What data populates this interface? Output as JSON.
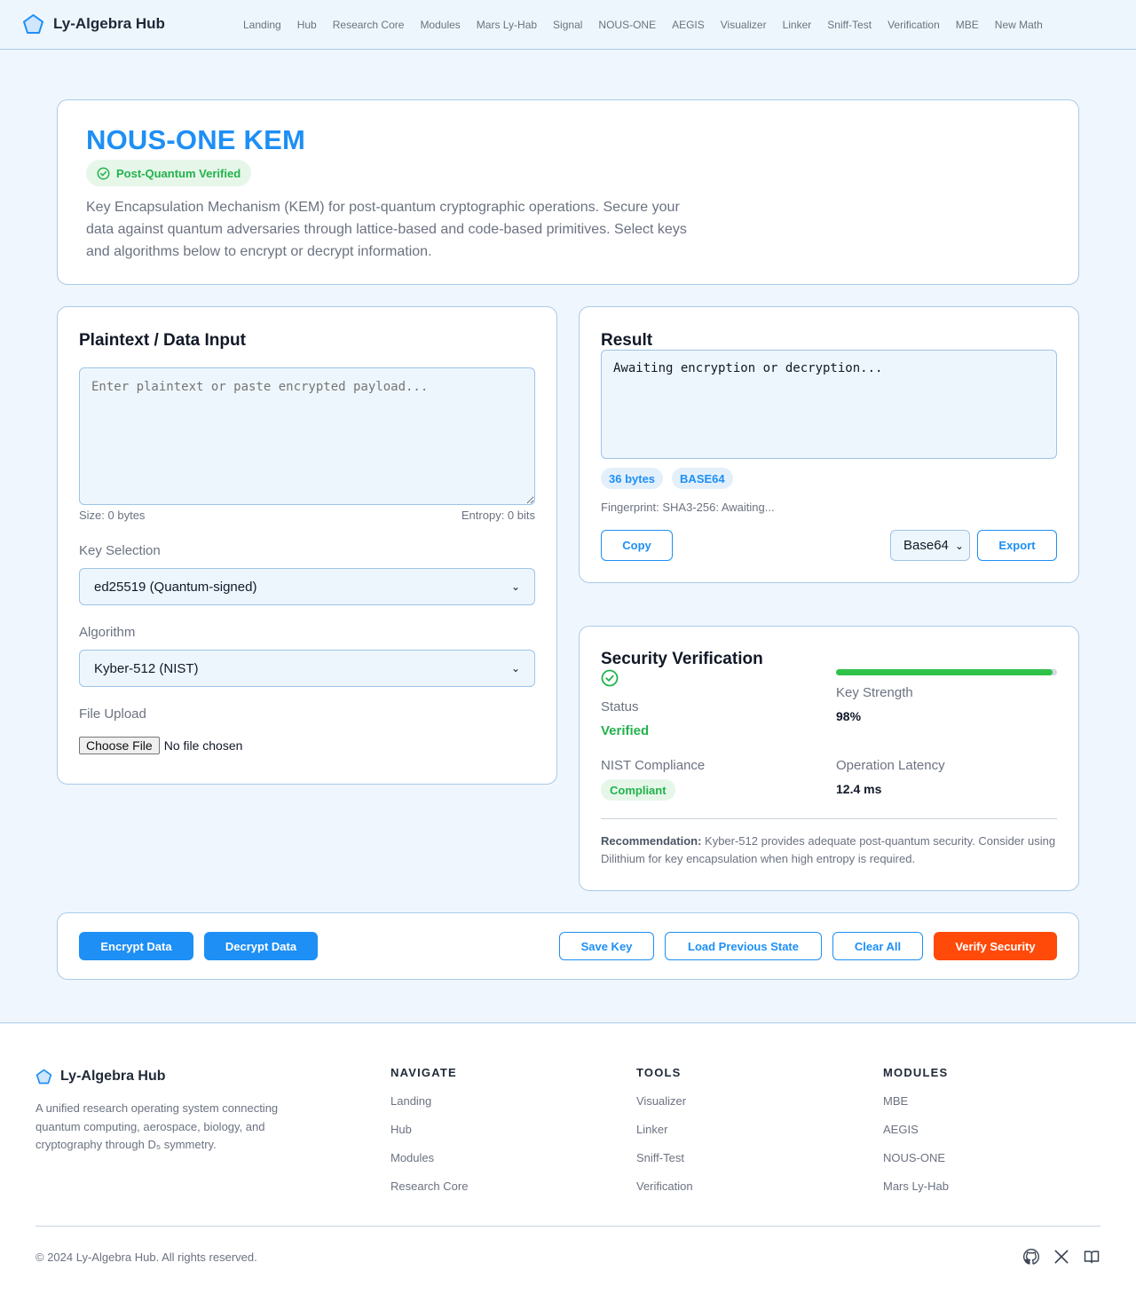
{
  "brand": {
    "name": "Ly-Algebra Hub",
    "logo_icon": "pentagon-icon"
  },
  "nav": [
    "Landing",
    "Hub",
    "Research Core",
    "Modules",
    "Mars Ly-Hab",
    "Signal",
    "NOUS-ONE",
    "AEGIS",
    "Visualizer",
    "Linker",
    "Sniff-Test",
    "Verification",
    "MBE",
    "New Math"
  ],
  "hero": {
    "title": "NOUS-ONE KEM",
    "badge": "Post-Quantum Verified",
    "description": "Key Encapsulation Mechanism (KEM) for post-quantum cryptographic operations. Secure your data against quantum adversaries through lattice-based and code-based primitives. Select keys and algorithms below to encrypt or decrypt information."
  },
  "input": {
    "title": "Plaintext / Data Input",
    "placeholder": "Enter plaintext or paste encrypted payload...",
    "size": "Size: 0 bytes",
    "entropy": "Entropy: 0 bits",
    "key_label": "Key Selection",
    "key_value": "ed25519 (Quantum-signed)",
    "algo_label": "Algorithm",
    "algo_value": "Kyber-512 (NIST)",
    "file_label": "File Upload",
    "file_button": "Choose File",
    "file_status": "No file chosen"
  },
  "result": {
    "title": "Result",
    "output": "Awaiting encryption or decryption...",
    "bytes_pill": "36 bytes",
    "format_pill": "BASE64",
    "fingerprint": "Fingerprint: SHA3-256: Awaiting...",
    "copy_label": "Copy",
    "format_value": "Base64",
    "export_label": "Export"
  },
  "security": {
    "title": "Security Verification",
    "status_label": "Status",
    "status_value": "Verified",
    "strength_label": "Key Strength",
    "strength_value": "98%",
    "strength_fraction": 0.98,
    "nist_label": "NIST Compliance",
    "nist_value": "Compliant",
    "latency_label": "Operation Latency",
    "latency_value": "12.4 ms",
    "recommend_label": "Recommendation:",
    "recommend_text": " Kyber-512 provides adequate post-quantum security. Consider using Dilithium for key encapsulation when high entropy is required."
  },
  "actions": {
    "encrypt": "Encrypt Data",
    "decrypt": "Decrypt Data",
    "save_key": "Save Key",
    "load_state": "Load Previous State",
    "clear_all": "Clear All",
    "verify": "Verify Security"
  },
  "footer": {
    "brand": "Ly-Algebra Hub",
    "description": "A unified research operating system connecting quantum computing, aerospace, biology, and cryptography through D₅ symmetry.",
    "navigate_title": "NAVIGATE",
    "navigate": [
      "Landing",
      "Hub",
      "Modules",
      "Research Core"
    ],
    "tools_title": "TOOLS",
    "tools": [
      "Visualizer",
      "Linker",
      "Sniff-Test",
      "Verification"
    ],
    "modules_title": "MODULES",
    "modules": [
      "MBE",
      "AEGIS",
      "NOUS-ONE",
      "Mars Ly-Hab"
    ],
    "copyright": "© 2024 Ly-Algebra Hub. All rights reserved.",
    "social_icons": [
      "github-icon",
      "x-icon",
      "book-icon"
    ]
  },
  "colors": {
    "accent": "#1d8ff5",
    "success": "#22b24c",
    "danger": "#ff4a0a",
    "border": "#a9cbe9"
  }
}
